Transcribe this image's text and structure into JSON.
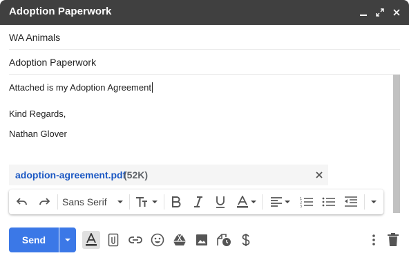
{
  "window": {
    "title": "Adoption Paperwork",
    "controls": [
      "minimize-icon",
      "expand-icon",
      "close-icon"
    ]
  },
  "recipients": {
    "value": "WA Animals"
  },
  "subject": {
    "value": "Adoption Paperwork"
  },
  "body": {
    "line1": "Attached is my Adoption Agreement",
    "line2": "Kind Regards,",
    "line3": "Nathan Glover"
  },
  "attachment": {
    "name": "adoption-agreement.pdf",
    "size": "(52K)"
  },
  "formatting": {
    "font": "Sans Serif",
    "buttons": [
      "undo-icon",
      "redo-icon",
      "font-icon",
      "text-size-icon",
      "bold-icon",
      "italic-icon",
      "underline-icon",
      "text-color-icon",
      "align-icon",
      "numbered-list-icon",
      "bulleted-list-icon",
      "indent-less-icon",
      "more-formatting-icon"
    ]
  },
  "bottom": {
    "send_label": "Send",
    "icons": [
      "formatting-options-icon",
      "attach-icon",
      "link-icon",
      "emoji-icon",
      "drive-icon",
      "photo-icon",
      "confidential-icon",
      "money-icon",
      "more-options-icon",
      "discard-icon"
    ]
  },
  "colors": {
    "titlebar": "#404040",
    "send": "#3b78e7",
    "attachment_link": "#1a57c3"
  }
}
